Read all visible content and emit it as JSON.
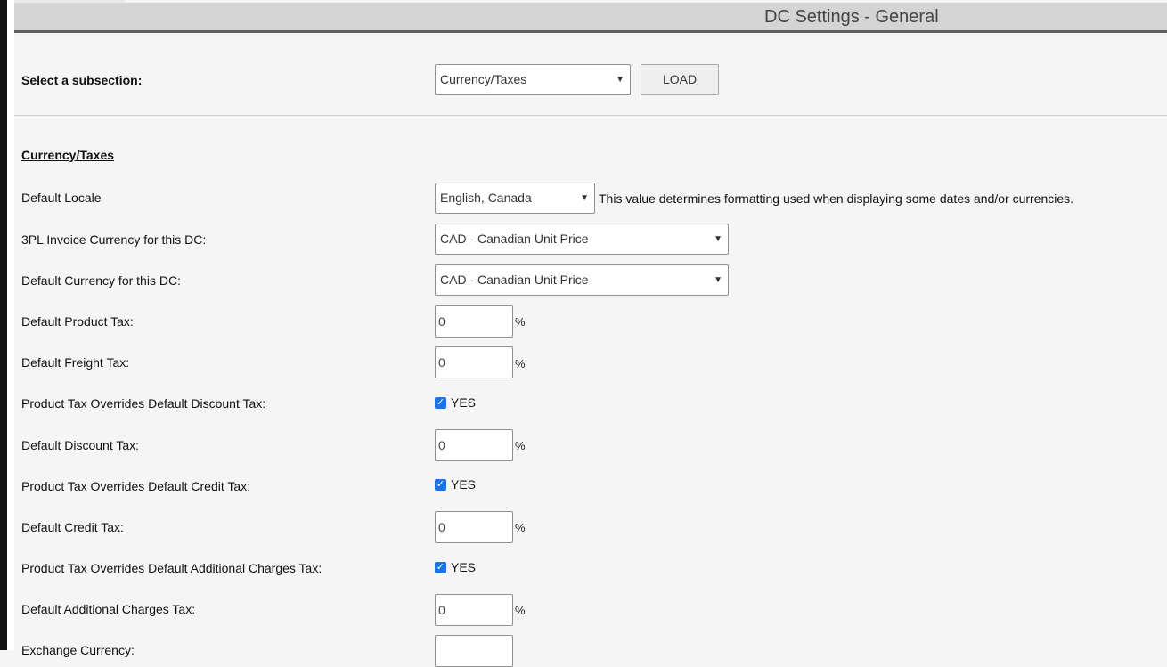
{
  "header": {
    "title": "DC Settings - General"
  },
  "subsection": {
    "label": "Select a subsection:",
    "selected": "Currency/Taxes",
    "load_label": "LOAD"
  },
  "section": {
    "title": "Currency/Taxes"
  },
  "fields": {
    "locale": {
      "label": "Default Locale",
      "value": "English, Canada",
      "hint": "This value determines formatting used when displaying some dates and/or currencies."
    },
    "invoice_currency": {
      "label": "3PL Invoice Currency for this DC:",
      "value": "CAD - Canadian Unit Price"
    },
    "default_currency": {
      "label": "Default Currency for this DC:",
      "value": "CAD - Canadian Unit Price"
    },
    "product_tax": {
      "label": "Default Product Tax:",
      "value": "0",
      "unit": "%"
    },
    "freight_tax": {
      "label": "Default Freight Tax:",
      "value": "0",
      "unit": "%"
    },
    "override_discount": {
      "label": "Product Tax Overrides Default Discount Tax:",
      "checked": true,
      "text": "YES"
    },
    "discount_tax": {
      "label": "Default Discount Tax:",
      "value": "0",
      "unit": "%"
    },
    "override_credit": {
      "label": "Product Tax Overrides Default Credit Tax:",
      "checked": true,
      "text": "YES"
    },
    "credit_tax": {
      "label": "Default Credit Tax:",
      "value": "0",
      "unit": "%"
    },
    "override_additional": {
      "label": "Product Tax Overrides Default Additional Charges Tax:",
      "checked": true,
      "text": "YES"
    },
    "additional_tax": {
      "label": "Default Additional Charges Tax:",
      "value": "0",
      "unit": "%"
    },
    "exchange_currency": {
      "label": "Exchange Currency:",
      "value": ""
    }
  },
  "icons": {
    "chevron": "chevron-down-icon",
    "check": "check-icon"
  }
}
